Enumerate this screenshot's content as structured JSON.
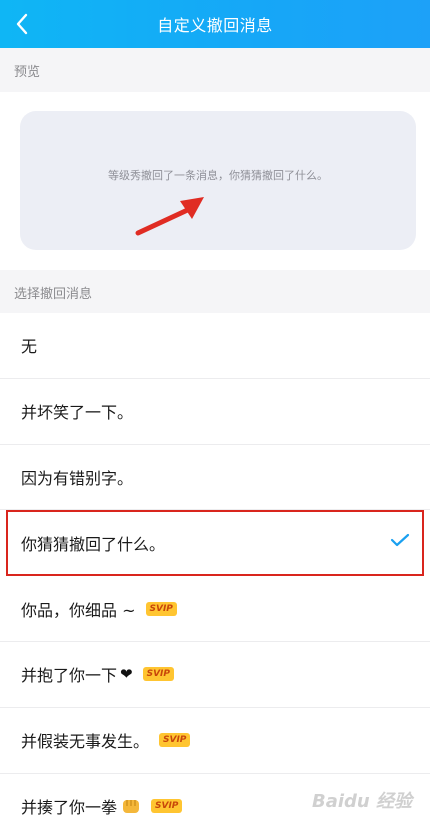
{
  "header": {
    "title": "自定义撤回消息"
  },
  "sections": {
    "preview_label": "预览",
    "choose_label": "选择撤回消息"
  },
  "preview": {
    "text": "等级秀撤回了一条消息，你猜猜撤回了什么。"
  },
  "options": [
    {
      "label": "无",
      "badge": ""
    },
    {
      "label": "并坏笑了一下。",
      "badge": ""
    },
    {
      "label": "因为有错别字。",
      "badge": ""
    },
    {
      "label": "你猜猜撤回了什么。",
      "badge": "",
      "selected": true
    },
    {
      "label": "你品，你细品 ~",
      "badge": "SVIP"
    },
    {
      "label": "并抱了你一下",
      "badge": "SVIP",
      "emoji": "heart"
    },
    {
      "label": "并假装无事发生。",
      "badge": "SVIP"
    },
    {
      "label": "并揍了你一拳",
      "badge": "SVIP",
      "emoji": "fist"
    }
  ],
  "colors": {
    "header": "#16a7f7",
    "check": "#1aa0f0",
    "highlight": "#d9251d",
    "badge": "#ffc531"
  },
  "watermark": "Baidu 经验"
}
